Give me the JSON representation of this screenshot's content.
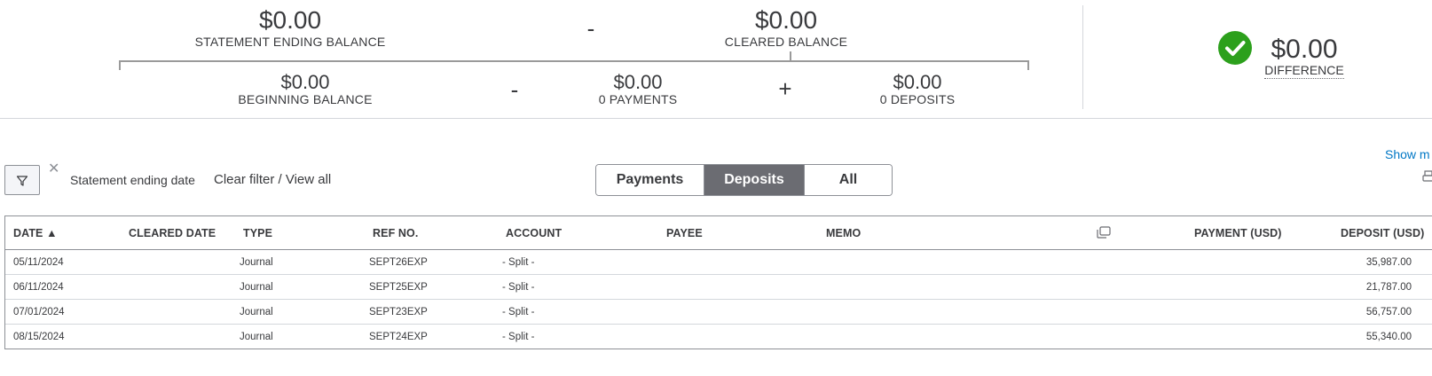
{
  "summary": {
    "statement_ending_balance": {
      "amount": "$0.00",
      "label": "STATEMENT ENDING BALANCE"
    },
    "minus_top": "-",
    "cleared_balance": {
      "amount": "$0.00",
      "label": "CLEARED BALANCE"
    },
    "beginning_balance": {
      "amount": "$0.00",
      "label": "BEGINNING BALANCE"
    },
    "minus_bottom": "-",
    "payments": {
      "amount": "$0.00",
      "label": "0 PAYMENTS"
    },
    "plus": "+",
    "deposits": {
      "amount": "$0.00",
      "label": "0 DEPOSITS"
    },
    "difference": {
      "amount": "$0.00",
      "label": "DIFFERENCE",
      "status_color": "#2ca01c",
      "icon": "check-circle-icon"
    }
  },
  "filter": {
    "filter_icon": "funnel-icon",
    "clear_icon": "close-icon",
    "label": "Statement ending date",
    "clear_link": "Clear filter / View all"
  },
  "tabs": [
    {
      "label": "Payments",
      "active": false
    },
    {
      "label": "Deposits",
      "active": true
    },
    {
      "label": "All",
      "active": false
    }
  ],
  "show_more": "Show m",
  "table": {
    "headers": {
      "date": "DATE ▲",
      "cleared_date": "CLEARED DATE",
      "type": "TYPE",
      "ref_no": "REF NO.",
      "account": "ACCOUNT",
      "payee": "PAYEE",
      "memo": "MEMO",
      "payment": "PAYMENT (USD)",
      "deposit": "DEPOSIT (USD)"
    },
    "rows": [
      {
        "date": "05/11/2024",
        "cleared_date": "",
        "type": "Journal",
        "ref_no": "SEPT26EXP",
        "account": "- Split -",
        "payee": "",
        "memo": "",
        "payment": "",
        "deposit": "35,987.00"
      },
      {
        "date": "06/11/2024",
        "cleared_date": "",
        "type": "Journal",
        "ref_no": "SEPT25EXP",
        "account": "- Split -",
        "payee": "",
        "memo": "",
        "payment": "",
        "deposit": "21,787.00"
      },
      {
        "date": "07/01/2024",
        "cleared_date": "",
        "type": "Journal",
        "ref_no": "SEPT23EXP",
        "account": "- Split -",
        "payee": "",
        "memo": "",
        "payment": "",
        "deposit": "56,757.00"
      },
      {
        "date": "08/15/2024",
        "cleared_date": "",
        "type": "Journal",
        "ref_no": "SEPT24EXP",
        "account": "- Split -",
        "payee": "",
        "memo": "",
        "payment": "",
        "deposit": "55,340.00"
      }
    ]
  }
}
